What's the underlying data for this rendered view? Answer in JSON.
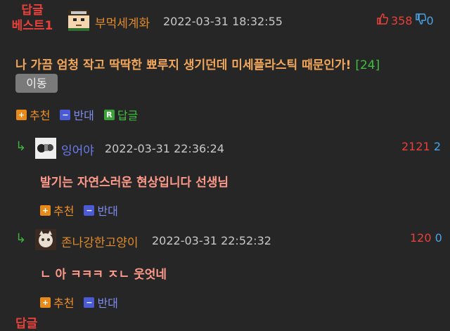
{
  "best": {
    "label_line1": "답글",
    "label_line2": "베스트1"
  },
  "post": {
    "author": "부먹세계화",
    "time": "2022-03-31 18:32:55",
    "up": "358",
    "down": "0",
    "title": "나 가끔 엄청 작고 딱딱한 뾰루지 생기던데 미세플라스틱 때문인가!",
    "comment_count": "[24]",
    "move_label": "이동"
  },
  "actions": {
    "up": "추천",
    "down": "반대",
    "reply": "답글"
  },
  "icons": {
    "up": "plus-square",
    "down": "minus-square",
    "reply": "r-square"
  },
  "comments": [
    {
      "author": "잉어야",
      "time": "2022-03-31 22:36:24",
      "up": "2121",
      "down": "2",
      "text": "발기는 자연스러운 현상입니다 선생님"
    },
    {
      "author": "존나강한고양이",
      "time": "2022-03-31 22:52:32",
      "up": "120",
      "down": "0",
      "text": "ㄴ 아 ㅋㅋㅋ ㅈㄴ 웃엇네"
    }
  ],
  "footer": {
    "next_label": "답글"
  },
  "colors": {
    "background": "#262626",
    "accent_red": "#e8413b",
    "nick_orange": "#e08a2a",
    "blue": "#4aa3e8",
    "green": "#3fb03f"
  }
}
